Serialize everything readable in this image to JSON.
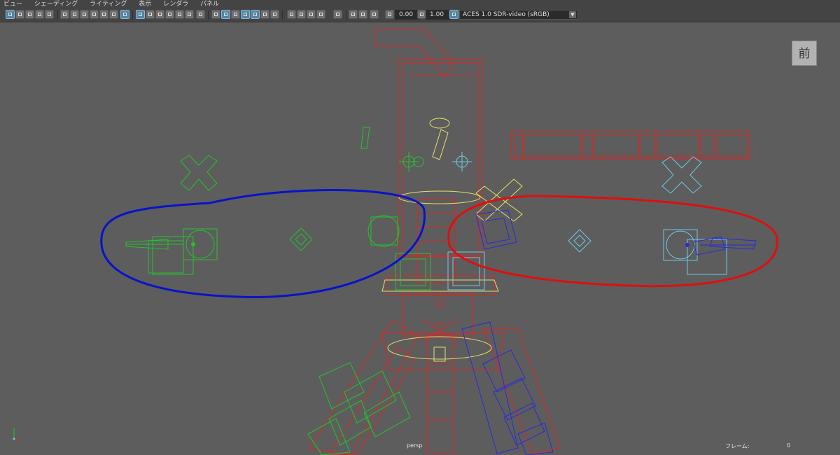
{
  "menu": {
    "items": [
      "ビュー",
      "シェーディング",
      "ライティング",
      "表示",
      "レンダラ",
      "パネル"
    ]
  },
  "toolbar": {
    "exposure": "0.00",
    "gamma": "1.00",
    "colorspace": "ACES 1.0 SDR-video (sRGB)"
  },
  "viewport": {
    "camera": "persp",
    "view_cube_label": "前",
    "frame_label": "フレーム:",
    "frame_value": "0"
  },
  "colors": {
    "rig_red": "#e02424",
    "rig_green": "#22c42a",
    "rig_blue": "#2b2bd8",
    "rig_cyan": "#6ec9e6",
    "rig_yellow": "#e8df6a",
    "annotation_blue": "#0a12c8",
    "annotation_red": "#e00e0e"
  }
}
